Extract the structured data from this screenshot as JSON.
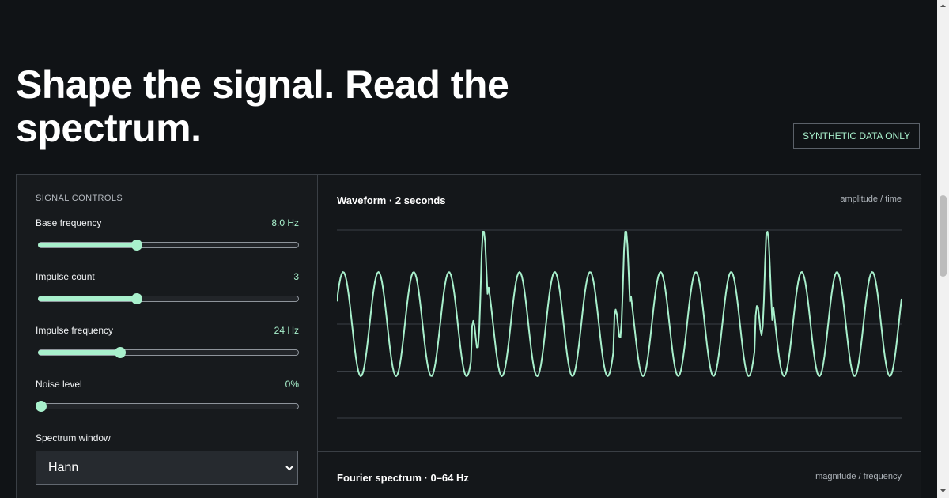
{
  "hero": {
    "title": "Shape the signal. Read the spectrum.",
    "badge": "SYNTHETIC DATA ONLY"
  },
  "controls": {
    "title": "SIGNAL CONTROLS",
    "base_frequency": {
      "label": "Base frequency",
      "value": "8.0 Hz",
      "level": 0.375
    },
    "impulse_count": {
      "label": "Impulse count",
      "value": "3",
      "level": 0.375
    },
    "impulse_frequency": {
      "label": "Impulse frequency",
      "value": "24 Hz",
      "level": 0.31
    },
    "noise_level": {
      "label": "Noise level",
      "value": "0%",
      "level": 0.0
    },
    "spectrum_window": {
      "label": "Spectrum window",
      "selected": "Hann"
    }
  },
  "waveform": {
    "title": "Waveform · 2 seconds",
    "note": "amplitude / time",
    "stroke": "#a8f0cc"
  },
  "spectrum": {
    "title": "Fourier spectrum · 0–64 Hz",
    "note": "magnitude / frequency"
  },
  "theme": {
    "background": "#101316",
    "accent": "#a8f0cc",
    "border": "#3a3f45"
  },
  "icons": {
    "select_chevron": "chevron-down-icon",
    "scroll_up": "scroll-up-icon",
    "scroll_down": "scroll-down-icon"
  }
}
